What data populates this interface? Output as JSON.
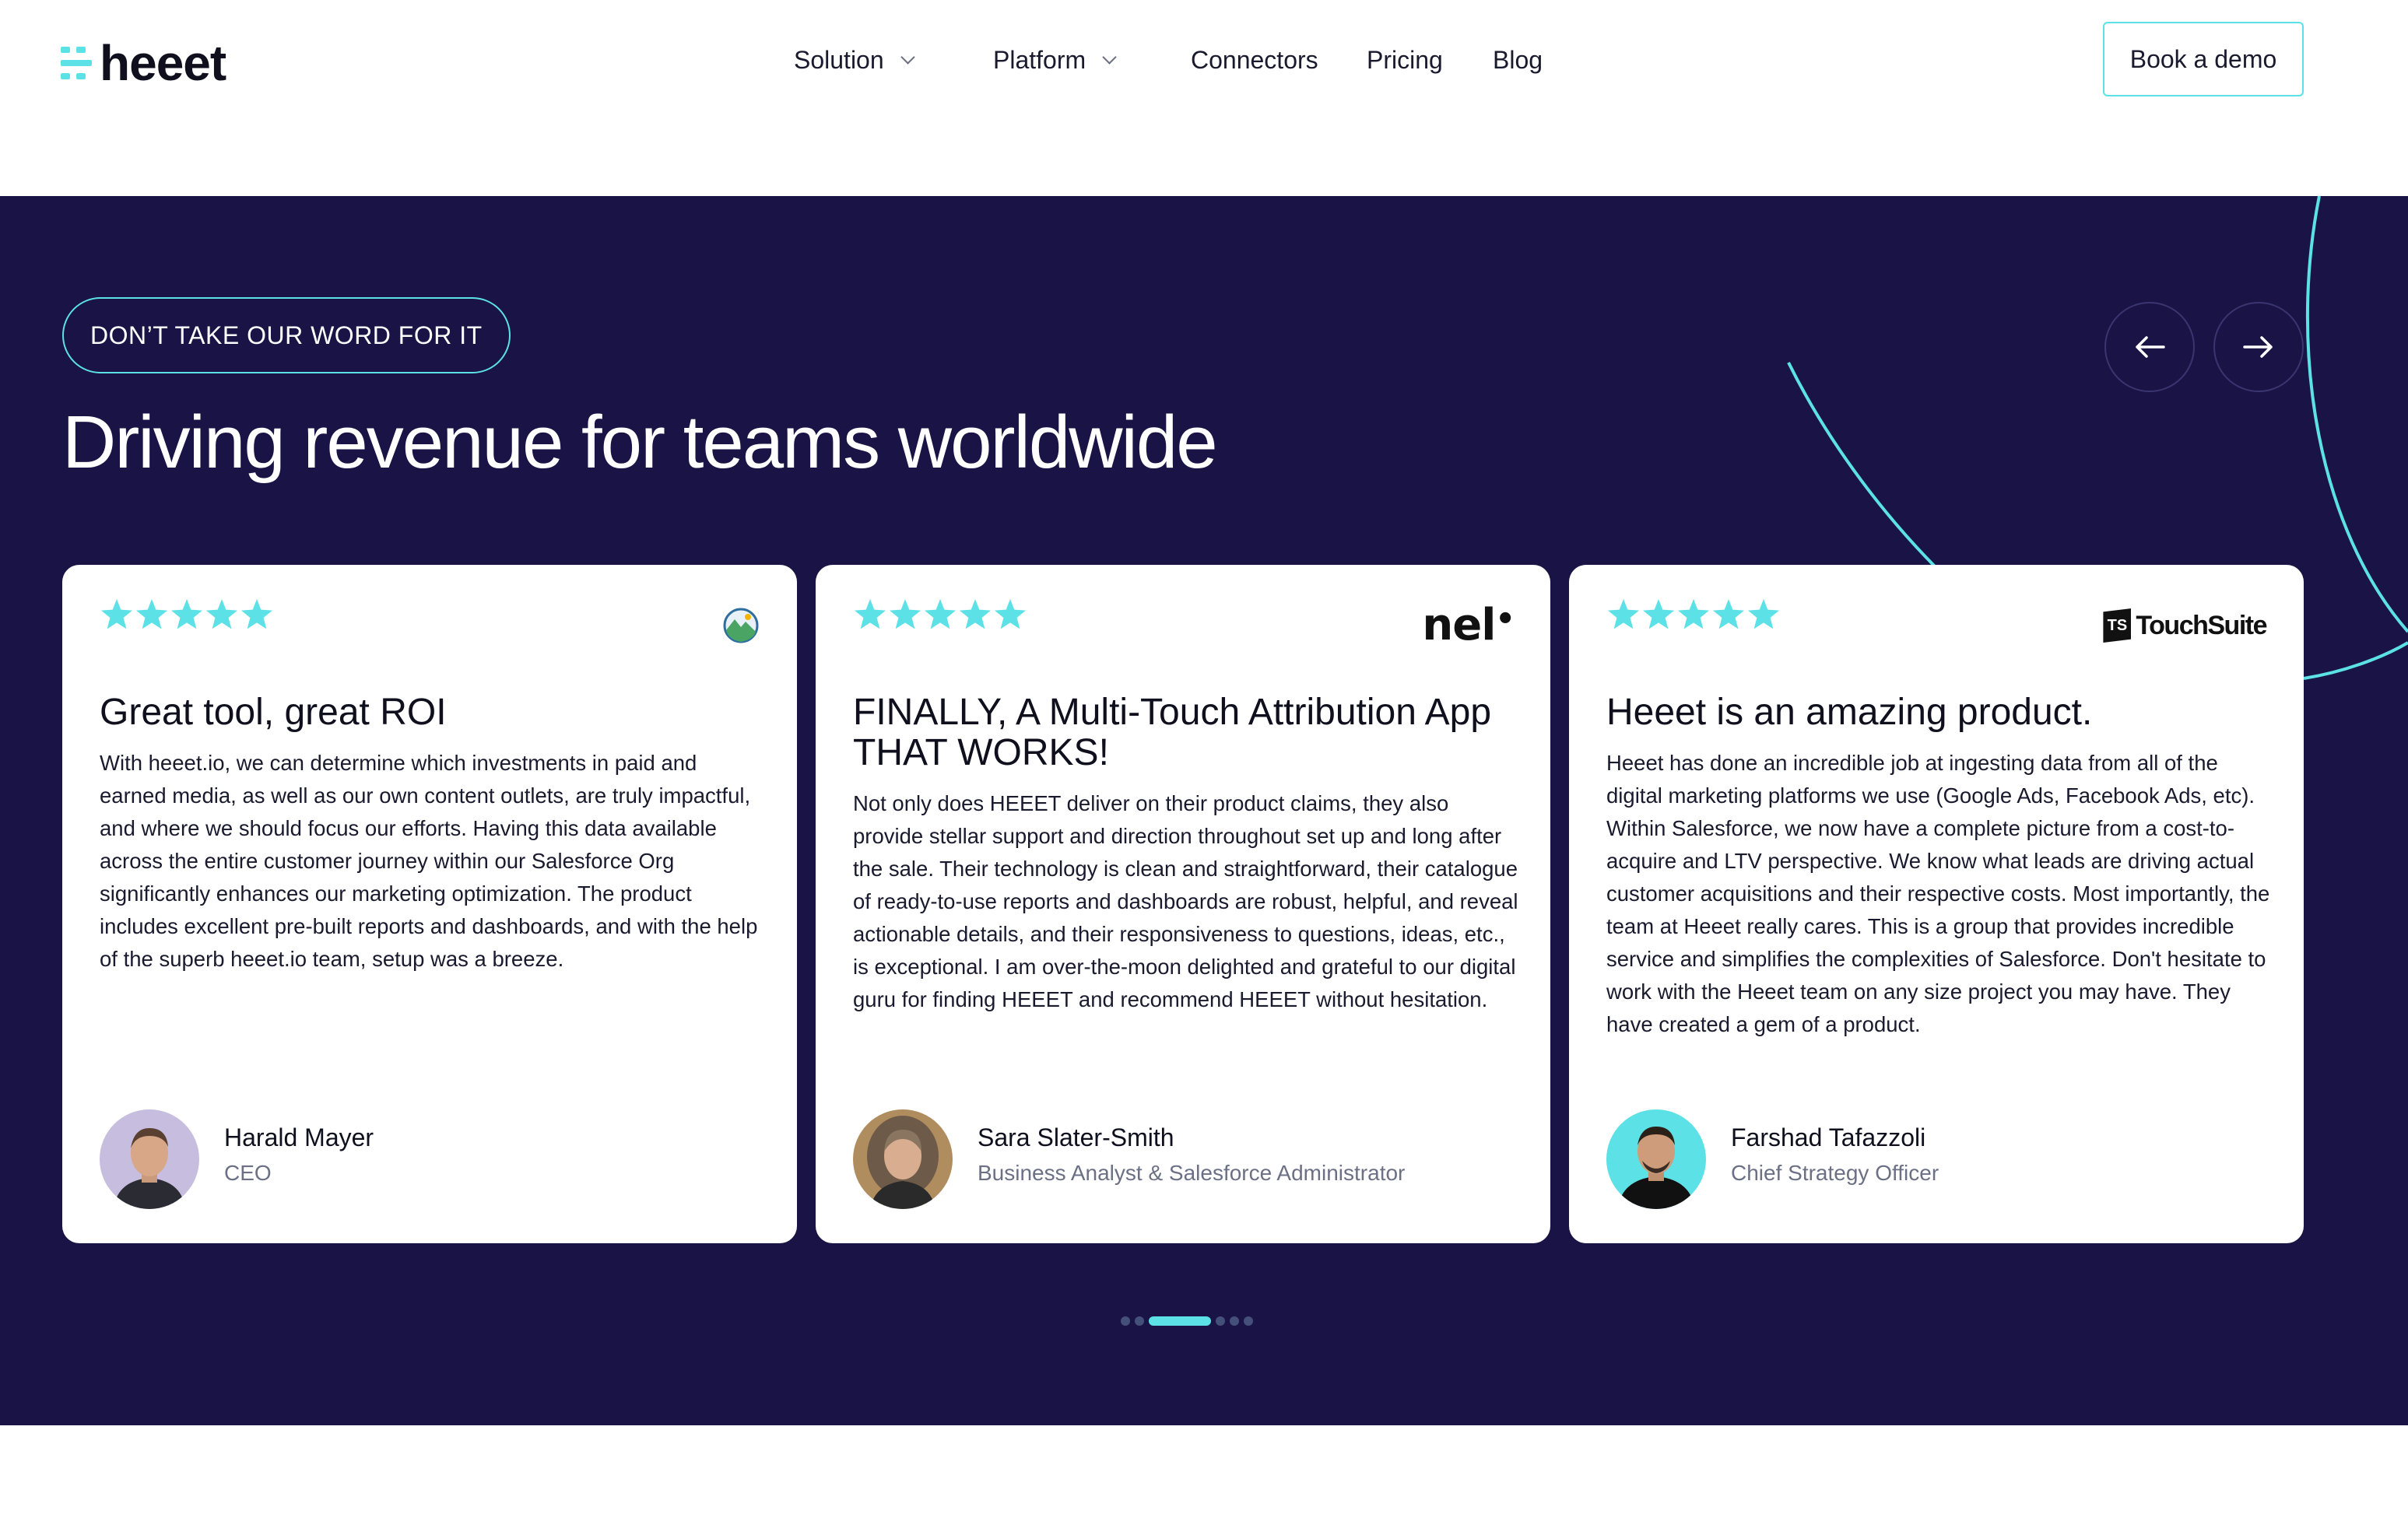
{
  "header": {
    "logo_text": "heeet",
    "nav": [
      {
        "label": "Solution",
        "has_dropdown": true
      },
      {
        "label": "Platform",
        "has_dropdown": true
      },
      {
        "label": "Connectors",
        "has_dropdown": false
      },
      {
        "label": "Pricing",
        "has_dropdown": false
      },
      {
        "label": "Blog",
        "has_dropdown": false
      }
    ],
    "cta_label": "Book a demo"
  },
  "testimonials": {
    "eyebrow": "DON’T TAKE OUR WORD FOR IT",
    "headline": "Driving revenue for teams worldwide",
    "prev_icon": "arrow-left-icon",
    "next_icon": "arrow-right-icon",
    "star_color": "#5ce1e6",
    "cards": [
      {
        "rating": 5,
        "brand_logo": "mountain-globe-logo",
        "title": "Great tool, great ROI",
        "body": "With heeet.io, we can determine which investments in paid and earned media, as well as our own content outlets, are truly impactful, and where we should focus our efforts. Having this data available across the entire customer journey within our Salesforce Org significantly enhances our marketing optimization. The product includes excellent pre-built reports and dashboards, and with the help of the superb heeet.io team, setup was a breeze.",
        "name": "Harald Mayer",
        "role": "CEO"
      },
      {
        "rating": 5,
        "brand_logo": "nel",
        "title": "FINALLY, A Multi-Touch Attribution App THAT WORKS!",
        "body": "Not only does HEEET deliver on their product claims, they also provide stellar support and direction throughout set up and long after the sale.  Their technology is clean and straightforward, their catalogue of ready-to-use reports and dashboards are robust, helpful, and reveal actionable details, and their responsiveness to questions, ideas, etc., is exceptional.  I am over-the-moon delighted and grateful to our digital guru for finding HEEET and recommend HEEET without hesitation.",
        "name": "Sara Slater-Smith",
        "role": "Business Analyst & Salesforce Administrator"
      },
      {
        "rating": 5,
        "brand_logo": "TouchSuite",
        "title": "Heeet is an amazing product.",
        "body": "Heeet has done an incredible job at ingesting data from all of the digital marketing platforms we use (Google Ads, Facebook Ads, etc). Within Salesforce, we now have a complete picture from a cost-to-acquire and LTV perspective. We know what leads are driving actual customer acquisitions and their respective costs.  Most importantly, the team at Heeet really cares. This is a group that provides incredible service and simplifies the complexities of Salesforce. Don't hesitate to work with the Heeet team on any size project you may have. They have created a gem of a product.",
        "name": "Farshad Tafazzoli",
        "role": "Chief Strategy Officer"
      }
    ],
    "pager": {
      "count": 6,
      "active_index": 2
    }
  },
  "colors": {
    "accent": "#5ce1e6",
    "section_bg": "#1a1446",
    "text_dark": "#0f0f1e",
    "muted": "#6b7085"
  }
}
